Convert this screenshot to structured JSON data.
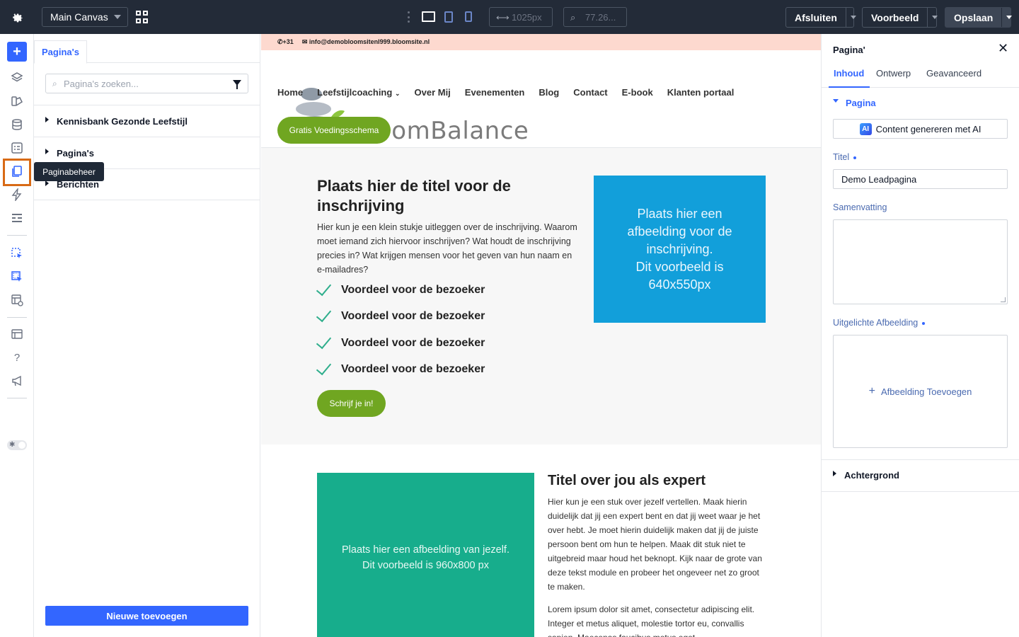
{
  "topbar": {
    "canvas_select": "Main Canvas",
    "width_value": "1025px",
    "zoom_value": "77.26...",
    "close_label": "Afsluiten",
    "preview_label": "Voorbeeld",
    "save_label": "Opslaan"
  },
  "rail": {
    "tooltip": "Paginabeheer",
    "icons": [
      "add-icon",
      "layers-icon",
      "theme-icon",
      "database-icon",
      "forms-icon",
      "pages-icon",
      "lightning-icon",
      "sections-icon",
      "element-picker-icon",
      "multi-picker-icon",
      "preview-layout-icon",
      "templates-icon",
      "help-icon",
      "announcement-icon",
      "theme-toggle"
    ]
  },
  "pages_panel": {
    "tab": "Pagina's",
    "search_placeholder": "Pagina's zoeken...",
    "items": [
      "Kennisbank Gezonde Leefstijl",
      "Pagina's",
      "Berichten"
    ],
    "new_button": "Nieuwe toevoegen"
  },
  "canvas": {
    "topstrip": {
      "phone": "+31",
      "email": "info@demobloomsitenl999.bloomsite.nl"
    },
    "logo_text": "oomBalance",
    "nav": [
      "Home",
      "Leefstijlcoaching",
      "Over Mij",
      "Evenementen",
      "Blog",
      "Contact",
      "E-book",
      "Klanten portaal"
    ],
    "nav_cta": "Gratis Voedingsschema",
    "section1": {
      "title": "Plaats hier de titel voor de inschrijving",
      "text": "Hier kun je een klein stukje uitleggen over de inschrijving. Waarom moet iemand zich hiervoor inschrijven? Wat houdt de inschrijving precies in? Wat krijgen mensen voor het geven van hun naam en e-mailadres?",
      "benefits": [
        "Voordeel voor de bezoeker",
        "Voordeel voor de bezoeker",
        "Voordeel voor de bezoeker",
        "Voordeel voor de bezoeker"
      ],
      "cta": "Schrijf je in!",
      "image_line1": "Plaats hier een afbeelding voor de inschrijving.",
      "image_line2": "Dit voorbeeld is 640x550px"
    },
    "section2": {
      "image_line1": "Plaats hier een afbeelding van jezelf.",
      "image_line2": "Dit voorbeeld is 960x800 px",
      "title": "Titel over jou als expert",
      "text1": "Hier kun je een stuk over jezelf vertellen. Maak hierin duidelijk dat jij een expert bent en dat jij weet waar je het over hebt. Je moet hierin duidelijk maken dat jij de juiste persoon bent om hun te helpen. Maak dit stuk niet te uitgebreid maar houd het beknopt. Kijk naar de grote van deze tekst module en probeer het ongeveer net zo groot te maken.",
      "text2": "Lorem ipsum dolor sit amet, consectetur adipiscing elit. Integer et metus aliquet, molestie tortor eu, convallis sapien. Maecenas faucibus metus eget"
    },
    "colors": {
      "accent_green": "#70a621",
      "image_blue": "#129fda",
      "image_teal": "#17ad8c",
      "topstrip": "#fdd9cf"
    }
  },
  "props": {
    "title": "Pagina'",
    "tabs": [
      "Inhoud",
      "Ontwerp",
      "Geavanceerd"
    ],
    "section_open": "Pagina",
    "ai_button": "Content genereren met AI",
    "ai_badge": "AI",
    "title_label": "Titel",
    "title_value": "Demo Leadpagina",
    "summary_label": "Samenvatting",
    "featured_label": "Uitgelichte Afbeelding",
    "add_image": "Afbeelding Toevoegen",
    "section_closed": "Achtergrond"
  },
  "colors": {
    "topbar": "#232b38",
    "primary": "#3366ff",
    "highlight": "#d86a15"
  }
}
